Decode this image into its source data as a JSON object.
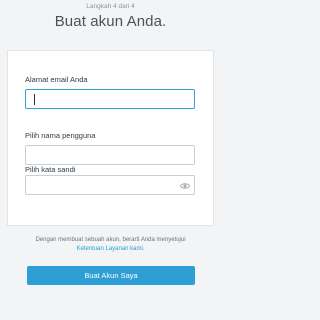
{
  "header": {
    "step": "Langkah 4 dari 4",
    "title": "Buat akun Anda."
  },
  "form": {
    "email_label": "Alamat email Anda",
    "email_value": "",
    "username_label": "Pilih nama pengguna",
    "username_value": "",
    "password_label": "Pilih kata sandi",
    "password_value": ""
  },
  "footer": {
    "terms_prefix": "Dengan membuat sebuah akun, berarti Anda menyetujui",
    "terms_link": "Ketentuan Layanan kami.",
    "submit_label": "Buat Akun Saya"
  },
  "colors": {
    "accent": "#2e9fd4",
    "background": "#f3f4f6"
  },
  "icons": {
    "password_toggle": "eye-icon"
  }
}
